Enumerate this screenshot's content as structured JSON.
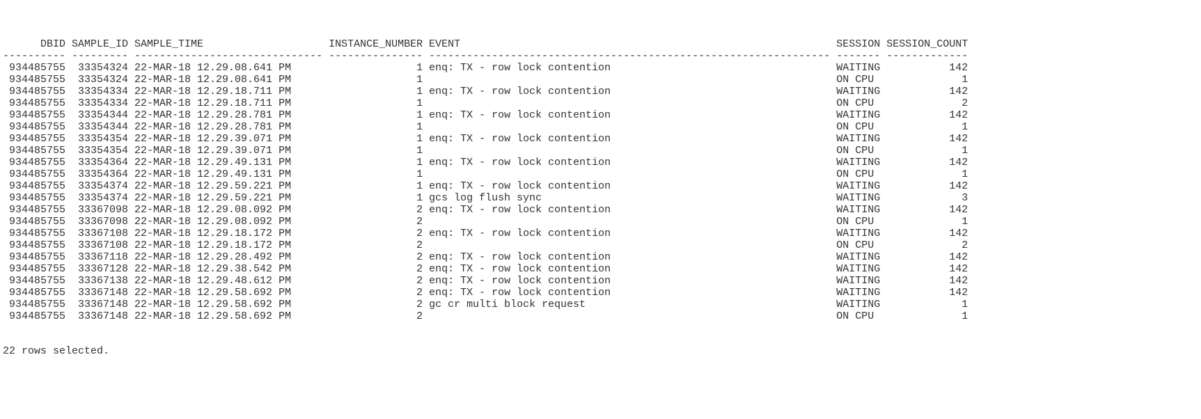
{
  "columns": [
    {
      "name": "DBID",
      "width": 10,
      "align": "right"
    },
    {
      "name": "SAMPLE_ID",
      "width": 9,
      "align": "right"
    },
    {
      "name": "SAMPLE_TIME",
      "width": 30,
      "align": "left"
    },
    {
      "name": "INSTANCE_NUMBER",
      "width": 15,
      "align": "right"
    },
    {
      "name": "EVENT",
      "width": 64,
      "align": "left"
    },
    {
      "name": "SESSION",
      "width": 7,
      "align": "left"
    },
    {
      "name": "SESSION_COUNT",
      "width": 13,
      "align": "right"
    }
  ],
  "rows": [
    {
      "dbid": "934485755",
      "sample_id": "33354324",
      "sample_time": "22-MAR-18 12.29.08.641 PM",
      "instance_number": "1",
      "event": "enq: TX - row lock contention",
      "session": "WAITING",
      "session_count": "142"
    },
    {
      "dbid": "934485755",
      "sample_id": "33354324",
      "sample_time": "22-MAR-18 12.29.08.641 PM",
      "instance_number": "1",
      "event": "",
      "session": "ON CPU",
      "session_count": "1"
    },
    {
      "dbid": "934485755",
      "sample_id": "33354334",
      "sample_time": "22-MAR-18 12.29.18.711 PM",
      "instance_number": "1",
      "event": "enq: TX - row lock contention",
      "session": "WAITING",
      "session_count": "142"
    },
    {
      "dbid": "934485755",
      "sample_id": "33354334",
      "sample_time": "22-MAR-18 12.29.18.711 PM",
      "instance_number": "1",
      "event": "",
      "session": "ON CPU",
      "session_count": "2"
    },
    {
      "dbid": "934485755",
      "sample_id": "33354344",
      "sample_time": "22-MAR-18 12.29.28.781 PM",
      "instance_number": "1",
      "event": "enq: TX - row lock contention",
      "session": "WAITING",
      "session_count": "142"
    },
    {
      "dbid": "934485755",
      "sample_id": "33354344",
      "sample_time": "22-MAR-18 12.29.28.781 PM",
      "instance_number": "1",
      "event": "",
      "session": "ON CPU",
      "session_count": "1"
    },
    {
      "dbid": "934485755",
      "sample_id": "33354354",
      "sample_time": "22-MAR-18 12.29.39.071 PM",
      "instance_number": "1",
      "event": "enq: TX - row lock contention",
      "session": "WAITING",
      "session_count": "142"
    },
    {
      "dbid": "934485755",
      "sample_id": "33354354",
      "sample_time": "22-MAR-18 12.29.39.071 PM",
      "instance_number": "1",
      "event": "",
      "session": "ON CPU",
      "session_count": "1"
    },
    {
      "dbid": "934485755",
      "sample_id": "33354364",
      "sample_time": "22-MAR-18 12.29.49.131 PM",
      "instance_number": "1",
      "event": "enq: TX - row lock contention",
      "session": "WAITING",
      "session_count": "142"
    },
    {
      "dbid": "934485755",
      "sample_id": "33354364",
      "sample_time": "22-MAR-18 12.29.49.131 PM",
      "instance_number": "1",
      "event": "",
      "session": "ON CPU",
      "session_count": "1"
    },
    {
      "dbid": "934485755",
      "sample_id": "33354374",
      "sample_time": "22-MAR-18 12.29.59.221 PM",
      "instance_number": "1",
      "event": "enq: TX - row lock contention",
      "session": "WAITING",
      "session_count": "142"
    },
    {
      "dbid": "934485755",
      "sample_id": "33354374",
      "sample_time": "22-MAR-18 12.29.59.221 PM",
      "instance_number": "1",
      "event": "gcs log flush sync",
      "session": "WAITING",
      "session_count": "3"
    },
    {
      "dbid": "934485755",
      "sample_id": "33367098",
      "sample_time": "22-MAR-18 12.29.08.092 PM",
      "instance_number": "2",
      "event": "enq: TX - row lock contention",
      "session": "WAITING",
      "session_count": "142"
    },
    {
      "dbid": "934485755",
      "sample_id": "33367098",
      "sample_time": "22-MAR-18 12.29.08.092 PM",
      "instance_number": "2",
      "event": "",
      "session": "ON CPU",
      "session_count": "1"
    },
    {
      "dbid": "934485755",
      "sample_id": "33367108",
      "sample_time": "22-MAR-18 12.29.18.172 PM",
      "instance_number": "2",
      "event": "enq: TX - row lock contention",
      "session": "WAITING",
      "session_count": "142"
    },
    {
      "dbid": "934485755",
      "sample_id": "33367108",
      "sample_time": "22-MAR-18 12.29.18.172 PM",
      "instance_number": "2",
      "event": "",
      "session": "ON CPU",
      "session_count": "2"
    },
    {
      "dbid": "934485755",
      "sample_id": "33367118",
      "sample_time": "22-MAR-18 12.29.28.492 PM",
      "instance_number": "2",
      "event": "enq: TX - row lock contention",
      "session": "WAITING",
      "session_count": "142"
    },
    {
      "dbid": "934485755",
      "sample_id": "33367128",
      "sample_time": "22-MAR-18 12.29.38.542 PM",
      "instance_number": "2",
      "event": "enq: TX - row lock contention",
      "session": "WAITING",
      "session_count": "142"
    },
    {
      "dbid": "934485755",
      "sample_id": "33367138",
      "sample_time": "22-MAR-18 12.29.48.612 PM",
      "instance_number": "2",
      "event": "enq: TX - row lock contention",
      "session": "WAITING",
      "session_count": "142"
    },
    {
      "dbid": "934485755",
      "sample_id": "33367148",
      "sample_time": "22-MAR-18 12.29.58.692 PM",
      "instance_number": "2",
      "event": "enq: TX - row lock contention",
      "session": "WAITING",
      "session_count": "142"
    },
    {
      "dbid": "934485755",
      "sample_id": "33367148",
      "sample_time": "22-MAR-18 12.29.58.692 PM",
      "instance_number": "2",
      "event": "gc cr multi block request",
      "session": "WAITING",
      "session_count": "1"
    },
    {
      "dbid": "934485755",
      "sample_id": "33367148",
      "sample_time": "22-MAR-18 12.29.58.692 PM",
      "instance_number": "2",
      "event": "",
      "session": "ON CPU",
      "session_count": "1"
    }
  ],
  "footer": "22 rows selected."
}
